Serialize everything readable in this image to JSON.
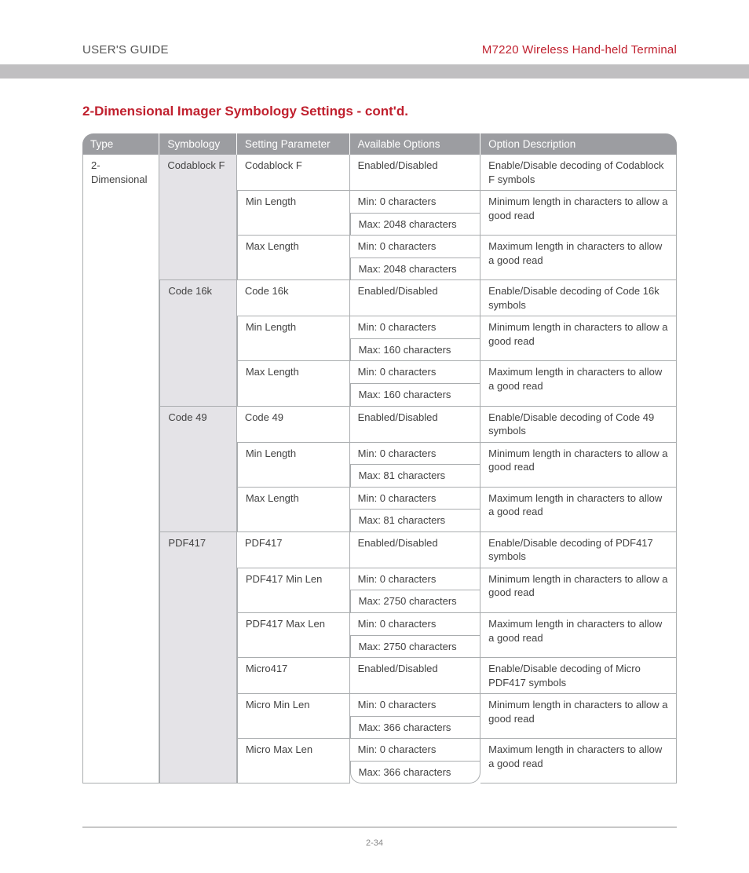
{
  "header": {
    "left": "USER'S GUIDE",
    "right": "M7220 Wireless Hand-held Terminal"
  },
  "section_title": "2-Dimensional Imager Symbology Settings - cont'd.",
  "columns": {
    "type": "Type",
    "symbology": "Symbology",
    "setting": "Setting Parameter",
    "options": "Available Options",
    "description": "Option Description"
  },
  "type_label": "2-Dimensional",
  "groups": [
    {
      "symbology": "Codablock F",
      "rows": [
        {
          "param": "Codablock F",
          "opts": [
            "Enabled/Disabled"
          ],
          "desc": "Enable/Disable decoding of  Codablock F symbols"
        },
        {
          "param": "Min Length",
          "opts": [
            "Min: 0 characters",
            "Max: 2048 characters"
          ],
          "desc": "Minimum length in characters to allow a good read"
        },
        {
          "param": "Max Length",
          "opts": [
            "Min: 0 characters",
            "Max: 2048 characters"
          ],
          "desc": "Maximum length in characters to allow a good read"
        }
      ]
    },
    {
      "symbology": "Code 16k",
      "rows": [
        {
          "param": "Code 16k",
          "opts": [
            "Enabled/Disabled"
          ],
          "desc": "Enable/Disable decoding of  Code 16k symbols"
        },
        {
          "param": "Min Length",
          "opts": [
            "Min: 0 characters",
            "Max: 160 characters"
          ],
          "desc": "Minimum length in characters to allow a good read"
        },
        {
          "param": "Max Length",
          "opts": [
            "Min: 0 characters",
            "Max: 160 characters"
          ],
          "desc": "Maximum length in characters to allow a good read"
        }
      ]
    },
    {
      "symbology": "Code 49",
      "rows": [
        {
          "param": "Code 49",
          "opts": [
            "Enabled/Disabled"
          ],
          "desc": "Enable/Disable decoding of  Code 49 symbols"
        },
        {
          "param": "Min Length",
          "opts": [
            "Min: 0 characters",
            "Max: 81 characters"
          ],
          "desc": "Minimum length in characters to allow a good read"
        },
        {
          "param": "Max Length",
          "opts": [
            "Min: 0 characters",
            "Max: 81 characters"
          ],
          "desc": "Maximum length in characters to allow a good read"
        }
      ]
    },
    {
      "symbology": "PDF417",
      "rows": [
        {
          "param": "PDF417",
          "opts": [
            "Enabled/Disabled"
          ],
          "desc": "Enable/Disable decoding of  PDF417 symbols"
        },
        {
          "param": "PDF417 Min Len",
          "opts": [
            "Min: 0 characters",
            "Max: 2750 characters"
          ],
          "desc": "Minimum length in characters to allow a good read"
        },
        {
          "param": "PDF417 Max Len",
          "opts": [
            "Min: 0 characters",
            "Max: 2750 characters"
          ],
          "desc": "Maximum length in characters to allow a good read"
        },
        {
          "param": "Micro417",
          "opts": [
            "Enabled/Disabled"
          ],
          "desc": "Enable/Disable decoding of  Micro PDF417 symbols"
        },
        {
          "param": "Micro Min Len",
          "opts": [
            "Min: 0 characters",
            "Max: 366 characters"
          ],
          "desc": "Minimum length in characters to allow a good read"
        },
        {
          "param": "Micro Max Len",
          "opts": [
            "Min: 0 characters",
            "Max: 366 characters"
          ],
          "desc": "Maximum length in characters to allow a good read"
        }
      ]
    }
  ],
  "page_number": "2-34"
}
